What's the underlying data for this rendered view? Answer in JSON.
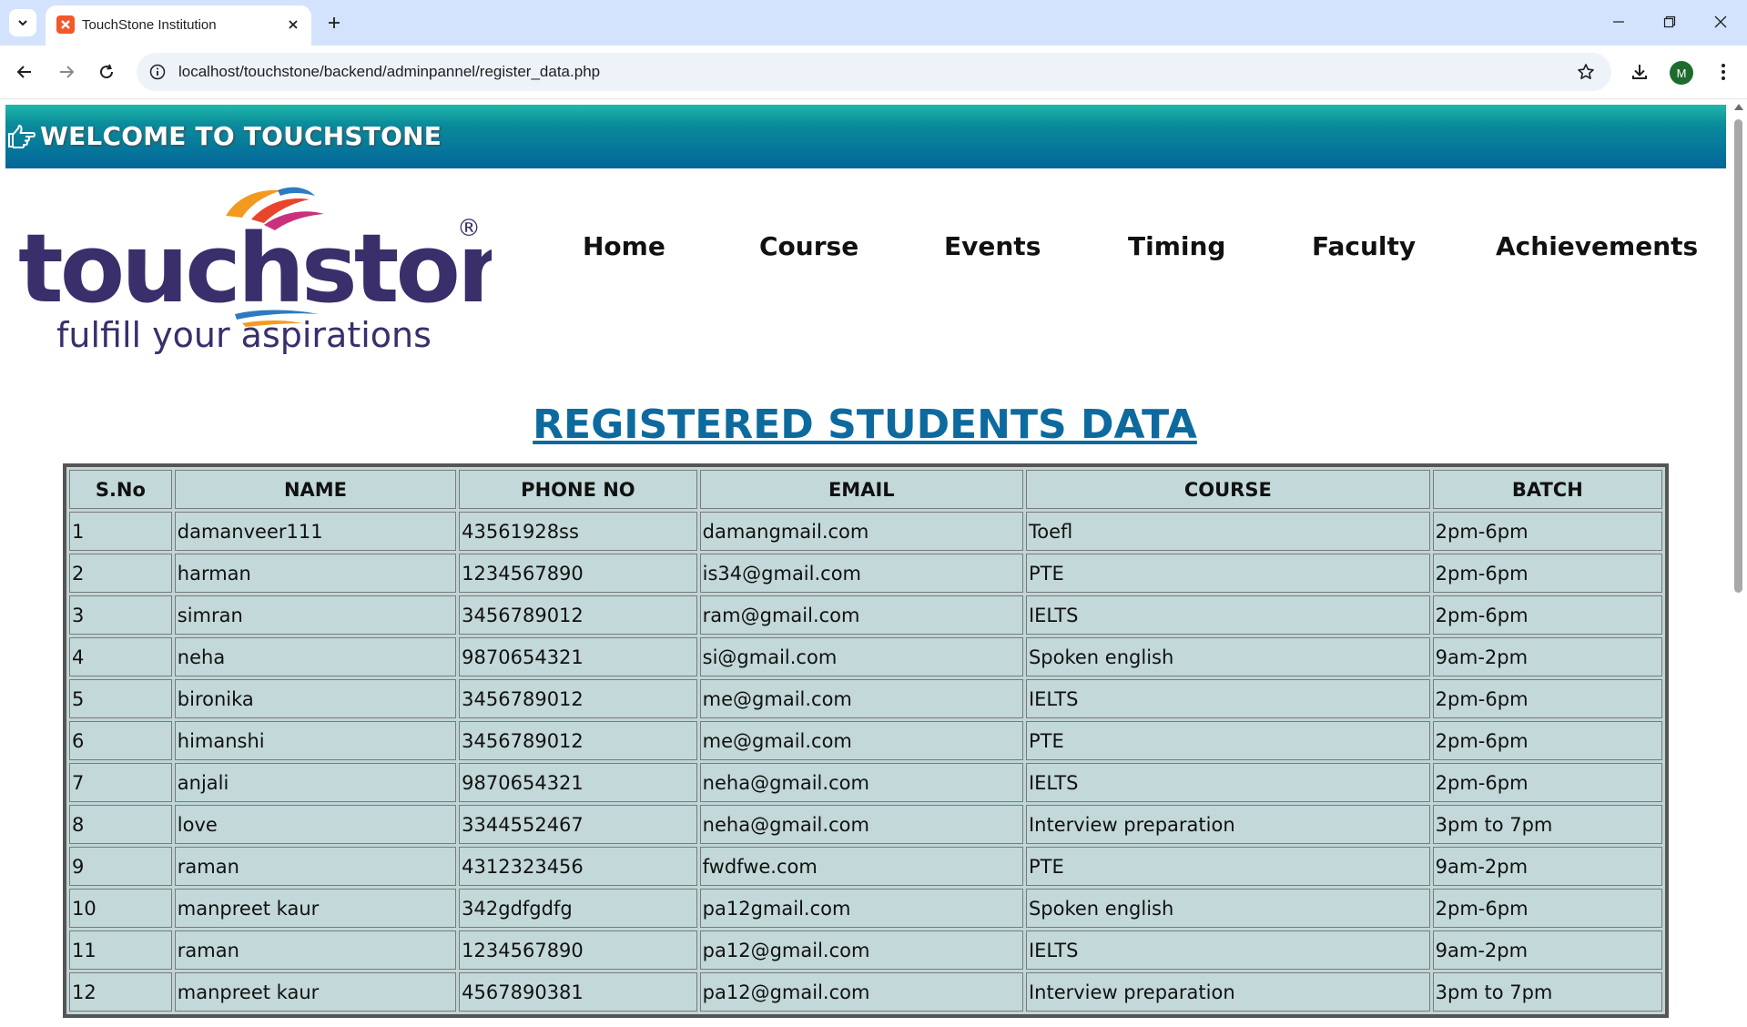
{
  "browser": {
    "tab_title": "TouchStone Institution",
    "url": "localhost/touchstone/backend/adminpannel/register_data.php",
    "avatar_letter": "M"
  },
  "site": {
    "welcome": "WELCOME TO TOUCHSTONE",
    "logo_word": "touchstone",
    "logo_tagline": "fulfill your aspirations",
    "logo_mark": "®",
    "nav": [
      "Home",
      "Course",
      "Events",
      "Timing",
      "Faculty",
      "Achievements"
    ]
  },
  "page": {
    "title": "REGISTERED STUDENTS DATA"
  },
  "table": {
    "headers": [
      "S.No",
      "NAME",
      "PHONE NO",
      "EMAIL",
      "COURSE",
      "BATCH"
    ],
    "rows": [
      [
        "1",
        "damanveer111",
        "43561928ss",
        "damangmail.com",
        "Toefl",
        "2pm-6pm"
      ],
      [
        "2",
        "harman",
        "1234567890",
        "is34@gmail.com",
        "PTE",
        "2pm-6pm"
      ],
      [
        "3",
        "simran",
        "3456789012",
        "ram@gmail.com",
        "IELTS",
        "2pm-6pm"
      ],
      [
        "4",
        "neha",
        "9870654321",
        "si@gmail.com",
        "Spoken english",
        "9am-2pm"
      ],
      [
        "5",
        "bironika",
        "3456789012",
        "me@gmail.com",
        "IELTS",
        "2pm-6pm"
      ],
      [
        "6",
        "himanshi",
        "3456789012",
        "me@gmail.com",
        "PTE",
        "2pm-6pm"
      ],
      [
        "7",
        "anjali",
        "9870654321",
        "neha@gmail.com",
        "IELTS",
        "2pm-6pm"
      ],
      [
        "8",
        "love",
        "3344552467",
        "neha@gmail.com",
        "Interview preparation",
        "3pm to 7pm"
      ],
      [
        "9",
        "raman",
        "4312323456",
        "fwdfwe.com",
        "PTE",
        "9am-2pm"
      ],
      [
        "10",
        "manpreet kaur",
        "342gdfgdfg",
        "pa12gmail.com",
        "Spoken english",
        "2pm-6pm"
      ],
      [
        "11",
        "raman",
        "1234567890",
        "pa12@gmail.com",
        "IELTS",
        "9am-2pm"
      ],
      [
        "12",
        "manpreet kaur",
        "4567890381",
        "pa12@gmail.com",
        "Interview preparation",
        "3pm to 7pm"
      ]
    ]
  },
  "colors": {
    "welcome_bar": "#036699",
    "title": "#0d6a9e",
    "cell": "#c3d8d8",
    "logo_text": "#3a2f6b"
  }
}
